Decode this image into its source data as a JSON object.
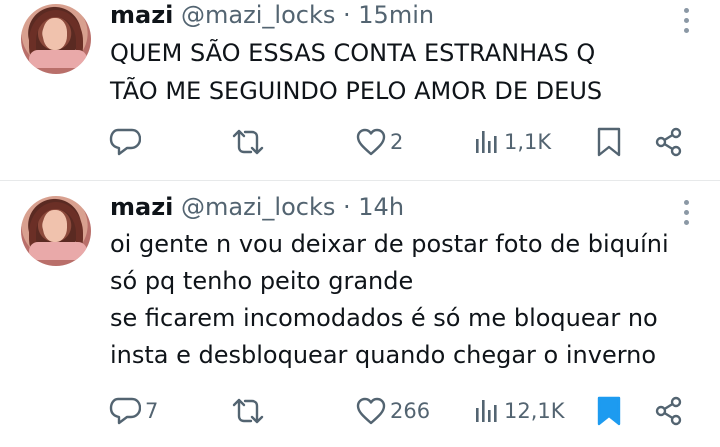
{
  "tweets": [
    {
      "name": "mazi",
      "handle": "@mazi_locks",
      "separator": "·",
      "time": "15min",
      "lines": [
        "QUEM SÃO ESSAS CONTA ESTRANHAS Q",
        "TÃO ME SEGUINDO PELO AMOR DE DEUS"
      ],
      "replies": "",
      "retweets": "",
      "likes": "2",
      "views": "1,1K",
      "bookmarked": false
    },
    {
      "name": "mazi",
      "handle": "@mazi_locks",
      "separator": "·",
      "time": "14h",
      "lines": [
        "oi gente n vou deixar de postar foto de biquíni",
        "só pq tenho peito grande",
        "se ficarem incomodados é só me bloquear no",
        "insta e desbloquear quando chegar o inverno"
      ],
      "replies": "7",
      "retweets": "",
      "likes": "266",
      "views": "12,1K",
      "bookmarked": true
    }
  ],
  "icons": {
    "reply": "reply-icon",
    "retweet": "retweet-icon",
    "like": "heart-icon",
    "views": "views-icon",
    "bookmark": "bookmark-icon",
    "share": "share-icon",
    "more": "more-icon"
  },
  "colors": {
    "text": "#0f1419",
    "muted": "#536471",
    "bookmark_active": "#1d9bf0",
    "divider": "#e7e9ea"
  }
}
